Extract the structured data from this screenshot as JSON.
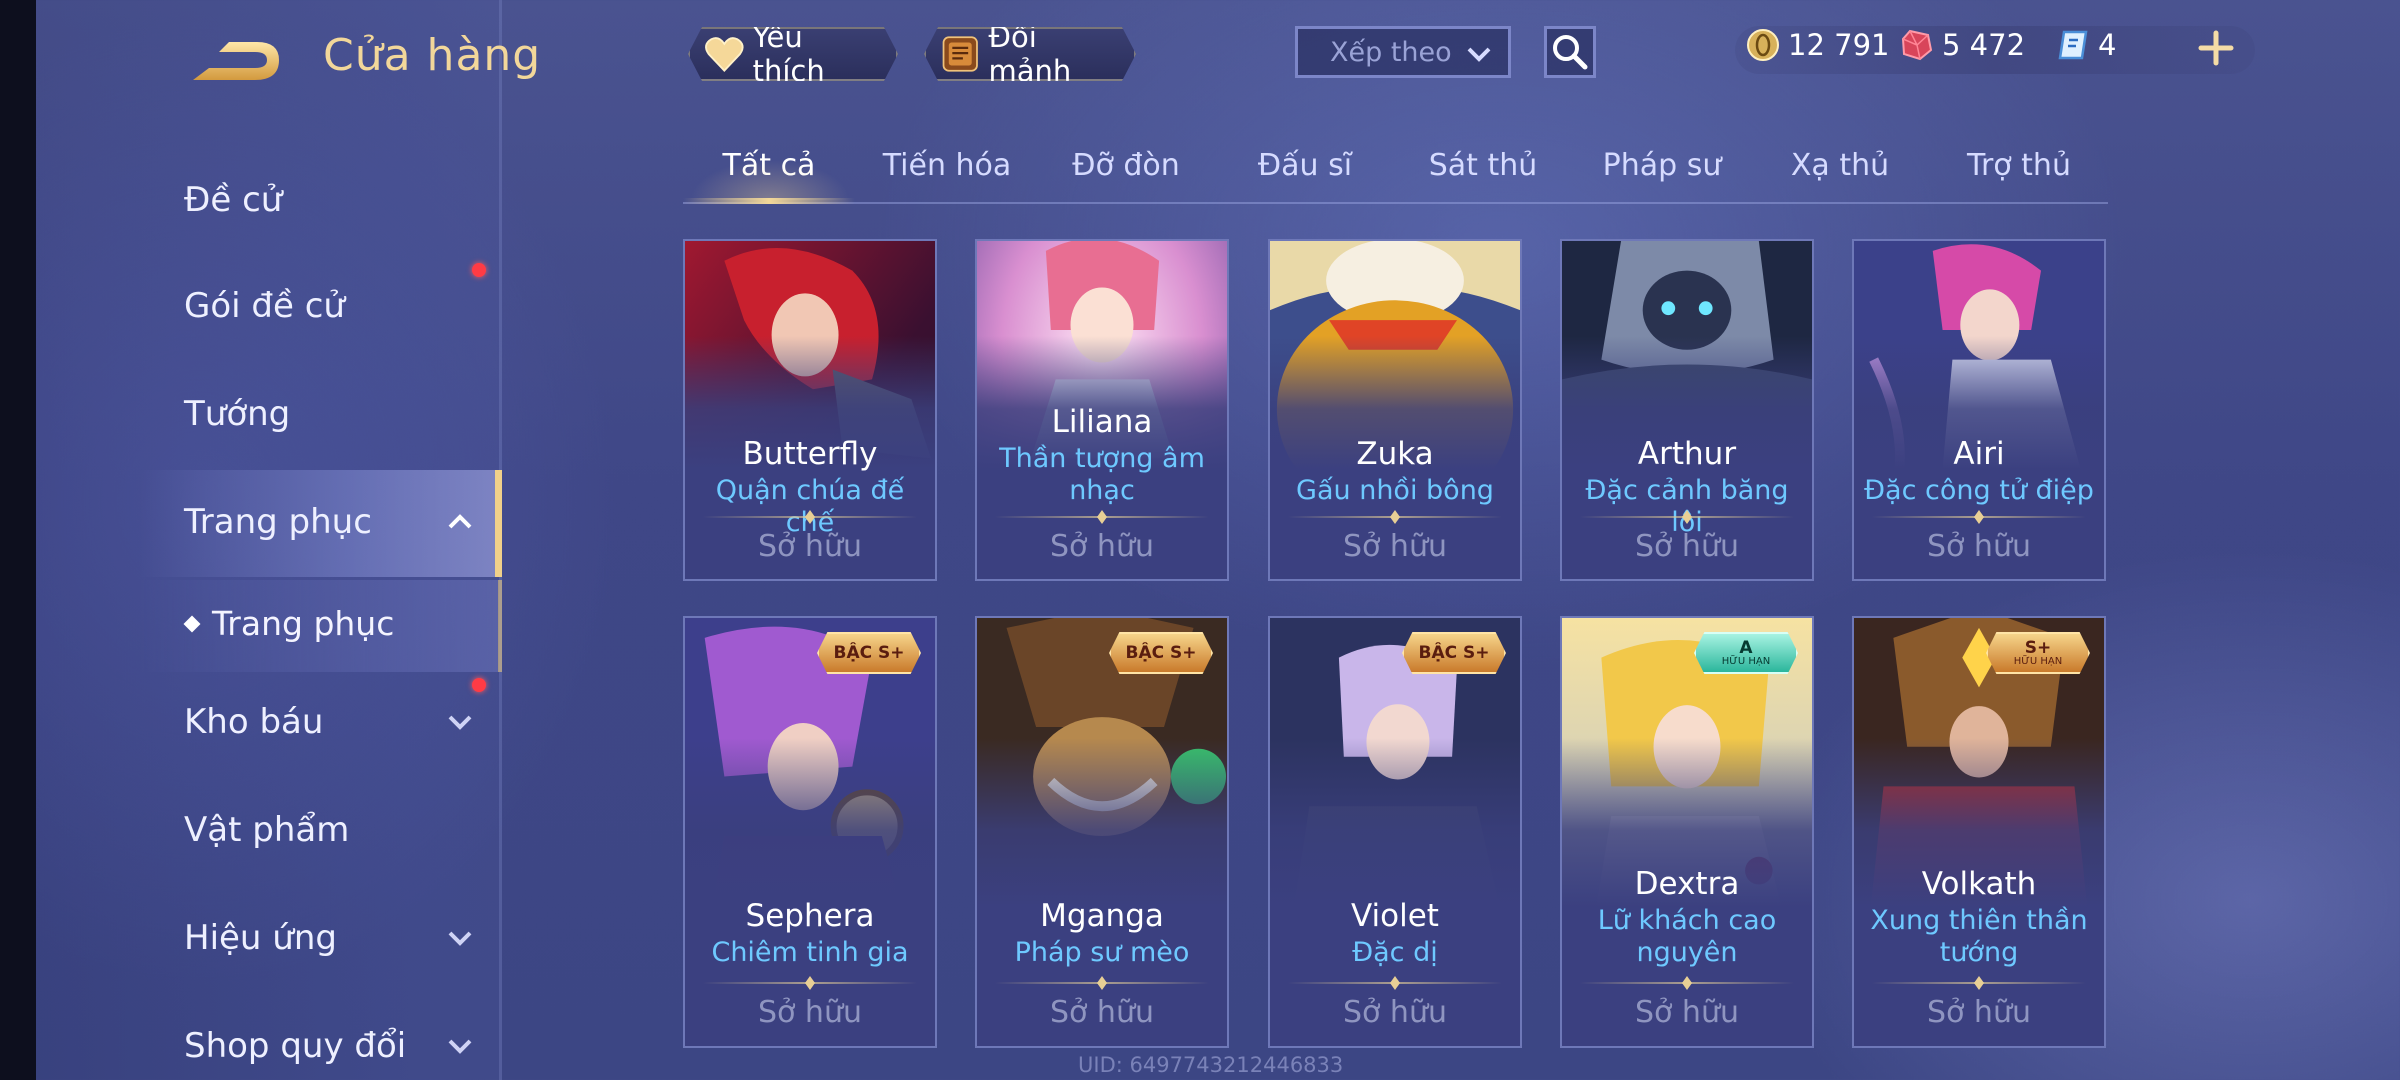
{
  "header": {
    "title": "Cửa hàng",
    "favorites_label": "Yêu thích",
    "exchange_label": "Đổi mảnh",
    "sort_label": "Xếp theo"
  },
  "currency": {
    "gold": "12 791",
    "gems": "5 472",
    "vouchers": "4"
  },
  "sidebar": {
    "items": [
      {
        "label": "Đề cử"
      },
      {
        "label": "Gói đề cử"
      },
      {
        "label": "Tướng"
      },
      {
        "label": "Trang phục"
      },
      {
        "label": "Kho báu"
      },
      {
        "label": "Vật phẩm"
      },
      {
        "label": "Hiệu ứng"
      },
      {
        "label": "Shop quy đổi"
      }
    ],
    "sub_item": "Trang phục"
  },
  "tabs": [
    "Tất cả",
    "Tiến hóa",
    "Đỡ đòn",
    "Đấu sĩ",
    "Sát thủ",
    "Pháp sư",
    "Xạ thủ",
    "Trợ thủ"
  ],
  "active_tab": "Tất cả",
  "cards": [
    {
      "hero": "Butterfly",
      "skin": "Quận chúa đế chế",
      "status": "Sở hữu",
      "badge": null,
      "icon": "butterfly-portrait"
    },
    {
      "hero": "Liliana",
      "skin": "Thần tượng âm nhạc",
      "status": "Sở hữu",
      "badge": null,
      "icon": "liliana-portrait"
    },
    {
      "hero": "Zuka",
      "skin": "Gấu nhồi bông",
      "status": "Sở hữu",
      "badge": null,
      "icon": "zuka-portrait"
    },
    {
      "hero": "Arthur",
      "skin": "Đặc cảnh băng lôi",
      "status": "Sở hữu",
      "badge": null,
      "icon": "arthur-portrait"
    },
    {
      "hero": "Airi",
      "skin": "Đặc công tử điệp",
      "status": "Sở hữu",
      "badge": null,
      "icon": "airi-portrait"
    },
    {
      "hero": "Sephera",
      "skin": "Chiêm tinh gia",
      "status": "Sở hữu",
      "badge": {
        "tier": "BẬC S+",
        "sub": ""
      },
      "icon": "sephera-portrait"
    },
    {
      "hero": "Mganga",
      "skin": "Pháp sư mèo",
      "status": "Sở hữu",
      "badge": {
        "tier": "BẬC S+",
        "sub": ""
      },
      "icon": "mganga-portrait"
    },
    {
      "hero": "Violet",
      "skin": "Đặc dị",
      "status": "Sở hữu",
      "badge": {
        "tier": "BẬC S+",
        "sub": ""
      },
      "icon": "violet-portrait"
    },
    {
      "hero": "Dextra",
      "skin": "Lữ khách cao nguyên",
      "status": "Sở hữu",
      "badge": {
        "tier": "A",
        "sub": "HỮU HẠN"
      },
      "icon": "dextra-portrait"
    },
    {
      "hero": "Volkath",
      "skin": "Xung thiên thần tướng",
      "status": "Sở hữu",
      "badge": {
        "tier": "S+",
        "sub": "HỮU HẠN"
      },
      "icon": "volkath-portrait"
    }
  ],
  "footer": {
    "uid": "UID: 6497743212446833"
  },
  "colors": {
    "accent_gold": "#f2d79a",
    "skin_name": "#6ec9ff",
    "notify_dot": "#ff3b45"
  }
}
